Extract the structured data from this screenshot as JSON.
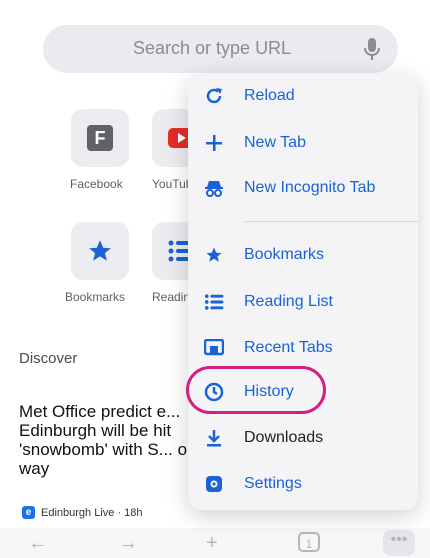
{
  "search": {
    "placeholder": "Search or type URL"
  },
  "shortcuts": [
    {
      "label": "Facebook",
      "icon": "facebook-icon"
    },
    {
      "label": "YouTube",
      "icon": "youtube-icon"
    }
  ],
  "shortcuts_row2": [
    {
      "label": "Bookmarks",
      "icon": "star-icon"
    },
    {
      "label": "Reading List",
      "icon": "list-icon"
    }
  ],
  "discover": {
    "title": "Discover"
  },
  "article": {
    "headline": "Met Office predict e... Edinburgh will be hit 'snowbomb' with S... on way",
    "source": "Edinburgh Live · 18h",
    "source_badge": "e"
  },
  "menu": {
    "items": [
      {
        "label": "Reload",
        "icon": "reload-icon"
      },
      {
        "label": "New Tab",
        "icon": "plus-icon"
      },
      {
        "label": "New Incognito Tab",
        "icon": "incognito-icon"
      },
      {
        "label": "Bookmarks",
        "icon": "star-icon"
      },
      {
        "label": "Reading List",
        "icon": "list-icon"
      },
      {
        "label": "Recent Tabs",
        "icon": "recent-tabs-icon"
      },
      {
        "label": "History",
        "icon": "history-icon"
      },
      {
        "label": "Downloads",
        "icon": "download-icon"
      },
      {
        "label": "Settings",
        "icon": "gear-icon"
      }
    ]
  },
  "toolbar": {
    "tab_count": "1"
  },
  "colors": {
    "accent": "#1a62d6",
    "highlight": "#d41f7e"
  }
}
